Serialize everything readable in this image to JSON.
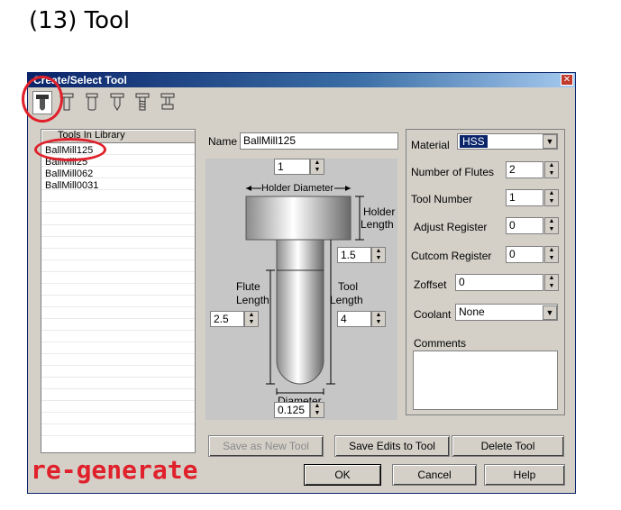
{
  "slide_title": "(13) Tool",
  "window": {
    "title": "Create/Select Tool",
    "close_glyph": "✕"
  },
  "toolbar": {
    "tools": [
      "ball-mill-tool-icon",
      "flat-mill-tool-icon",
      "bull-mill-tool-icon",
      "chamfer-tool-icon",
      "tap-tool-icon",
      "slot-tool-icon"
    ]
  },
  "library": {
    "header": "Tools In Library",
    "items": [
      "BallMill125",
      "BallMill25",
      "BallMill062",
      "BallMill0031"
    ]
  },
  "name": {
    "label": "Name",
    "value": "BallMill125"
  },
  "diagram": {
    "top_spinner": "1",
    "holder_diameter_label": "Holder Diameter",
    "holder_length_label_1": "Holder",
    "holder_length_label_2": "Length",
    "holder_length_value": "1.5",
    "flute_length_label_1": "Flute",
    "flute_length_label_2": "Length",
    "flute_length_value": "2.5",
    "tool_length_label_1": "Tool",
    "tool_length_label_2": "Length",
    "tool_length_value": "4",
    "diameter_label": "Diameter",
    "diameter_value": "0.125"
  },
  "right": {
    "material_label": "Material",
    "material_value": "HSS",
    "flutes_label": "Number of Flutes",
    "flutes_value": "2",
    "tool_number_label": "Tool Number",
    "tool_number_value": "1",
    "adjust_label": "Adjust Register",
    "adjust_value": "0",
    "cutcom_label": "Cutcom Register",
    "cutcom_value": "0",
    "zoffset_label": "Zoffset",
    "zoffset_value": "0",
    "coolant_label": "Coolant",
    "coolant_value": "None",
    "comments_label": "Comments"
  },
  "buttons": {
    "save_new": "Save as New Tool",
    "save_edits": "Save Edits to Tool",
    "delete": "Delete Tool",
    "ok": "OK",
    "cancel": "Cancel",
    "help": "Help"
  },
  "annotation": "re-generate",
  "colors": {
    "accent_red": "#e0202a",
    "titlebar": "#0a246a",
    "selection": "#0a246a"
  }
}
